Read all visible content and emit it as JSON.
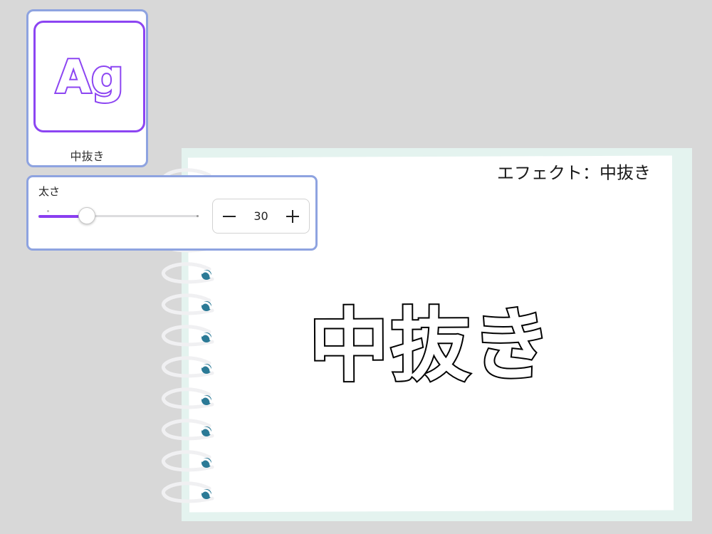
{
  "notebook": {
    "label": "エフェクト：中抜き",
    "sample_text": "中抜き"
  },
  "effect_card": {
    "thumbnail_text": "Ag",
    "name": "中抜き",
    "accent_color": "#8c45f2",
    "border_color": "#8ea3e0"
  },
  "thickness": {
    "label": "太さ",
    "value": "30",
    "slider_fraction": 0.3,
    "fill_color": "#8a3ef0",
    "minus_icon": "minus-icon",
    "plus_icon": "plus-icon"
  }
}
